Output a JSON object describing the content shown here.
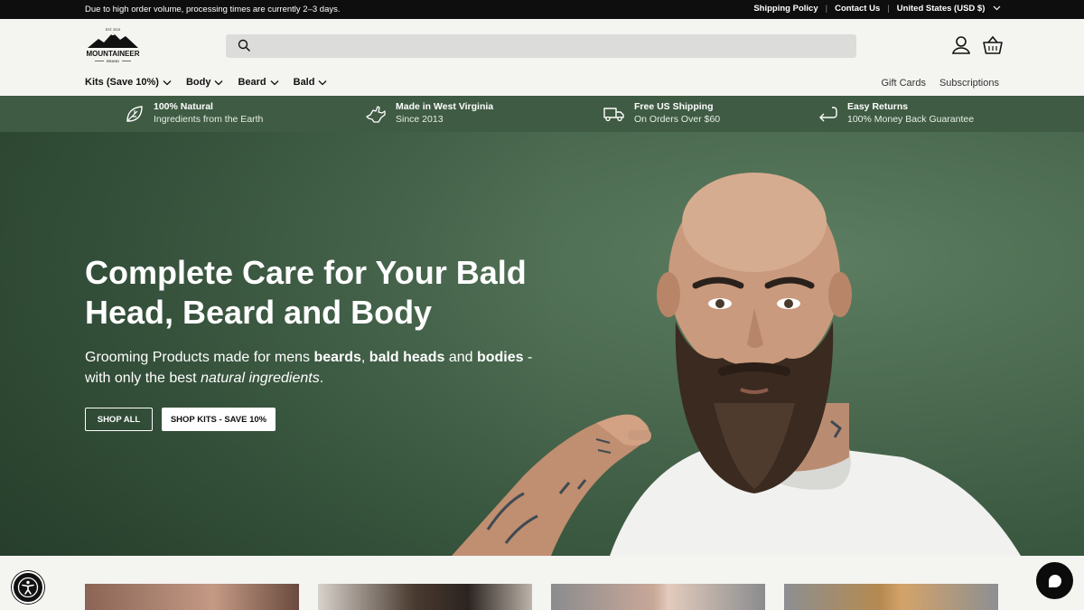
{
  "announcement": {
    "message": "Due to high order volume, processing times are currently 2–3 days.",
    "links": [
      "Shipping Policy",
      "Contact Us"
    ],
    "region": "United States (USD $)"
  },
  "header": {
    "logo": {
      "text": "MOUNTAINEER",
      "sub": "BRAND",
      "est": "EST. 2013"
    },
    "search": {
      "placeholder": ""
    },
    "icons": [
      "account-icon",
      "cart-icon"
    ]
  },
  "nav": {
    "items": [
      "Kits (Save 10%)",
      "Body",
      "Beard",
      "Bald"
    ],
    "right": [
      "Gift Cards",
      "Subscriptions"
    ]
  },
  "usp": [
    {
      "title": "100% Natural",
      "sub": "Ingredients from the Earth",
      "icon": "leaf-icon"
    },
    {
      "title": "Made in West Virginia",
      "sub": "Since 2013",
      "icon": "west-virginia-icon"
    },
    {
      "title": "Free US Shipping",
      "sub": "On Orders Over $60",
      "icon": "truck-icon"
    },
    {
      "title": "Easy Returns",
      "sub": "100% Money Back Guarantee",
      "icon": "return-arrow-icon"
    }
  ],
  "hero": {
    "headline": "Complete Care for Your Bald Head, Beard and Body",
    "sub_parts": [
      "Grooming Products made for mens ",
      "beards",
      ", ",
      "bald heads",
      " and ",
      "bodies",
      " - with only the best ",
      "natural ingredients",
      "."
    ],
    "buttons": [
      "SHOP ALL",
      "SHOP KITS - SAVE 10%"
    ]
  },
  "colors": {
    "usp_bg": "#3f5b43",
    "hero_bg": "#4b6a50",
    "announce_bg": "#0e0e0e"
  }
}
